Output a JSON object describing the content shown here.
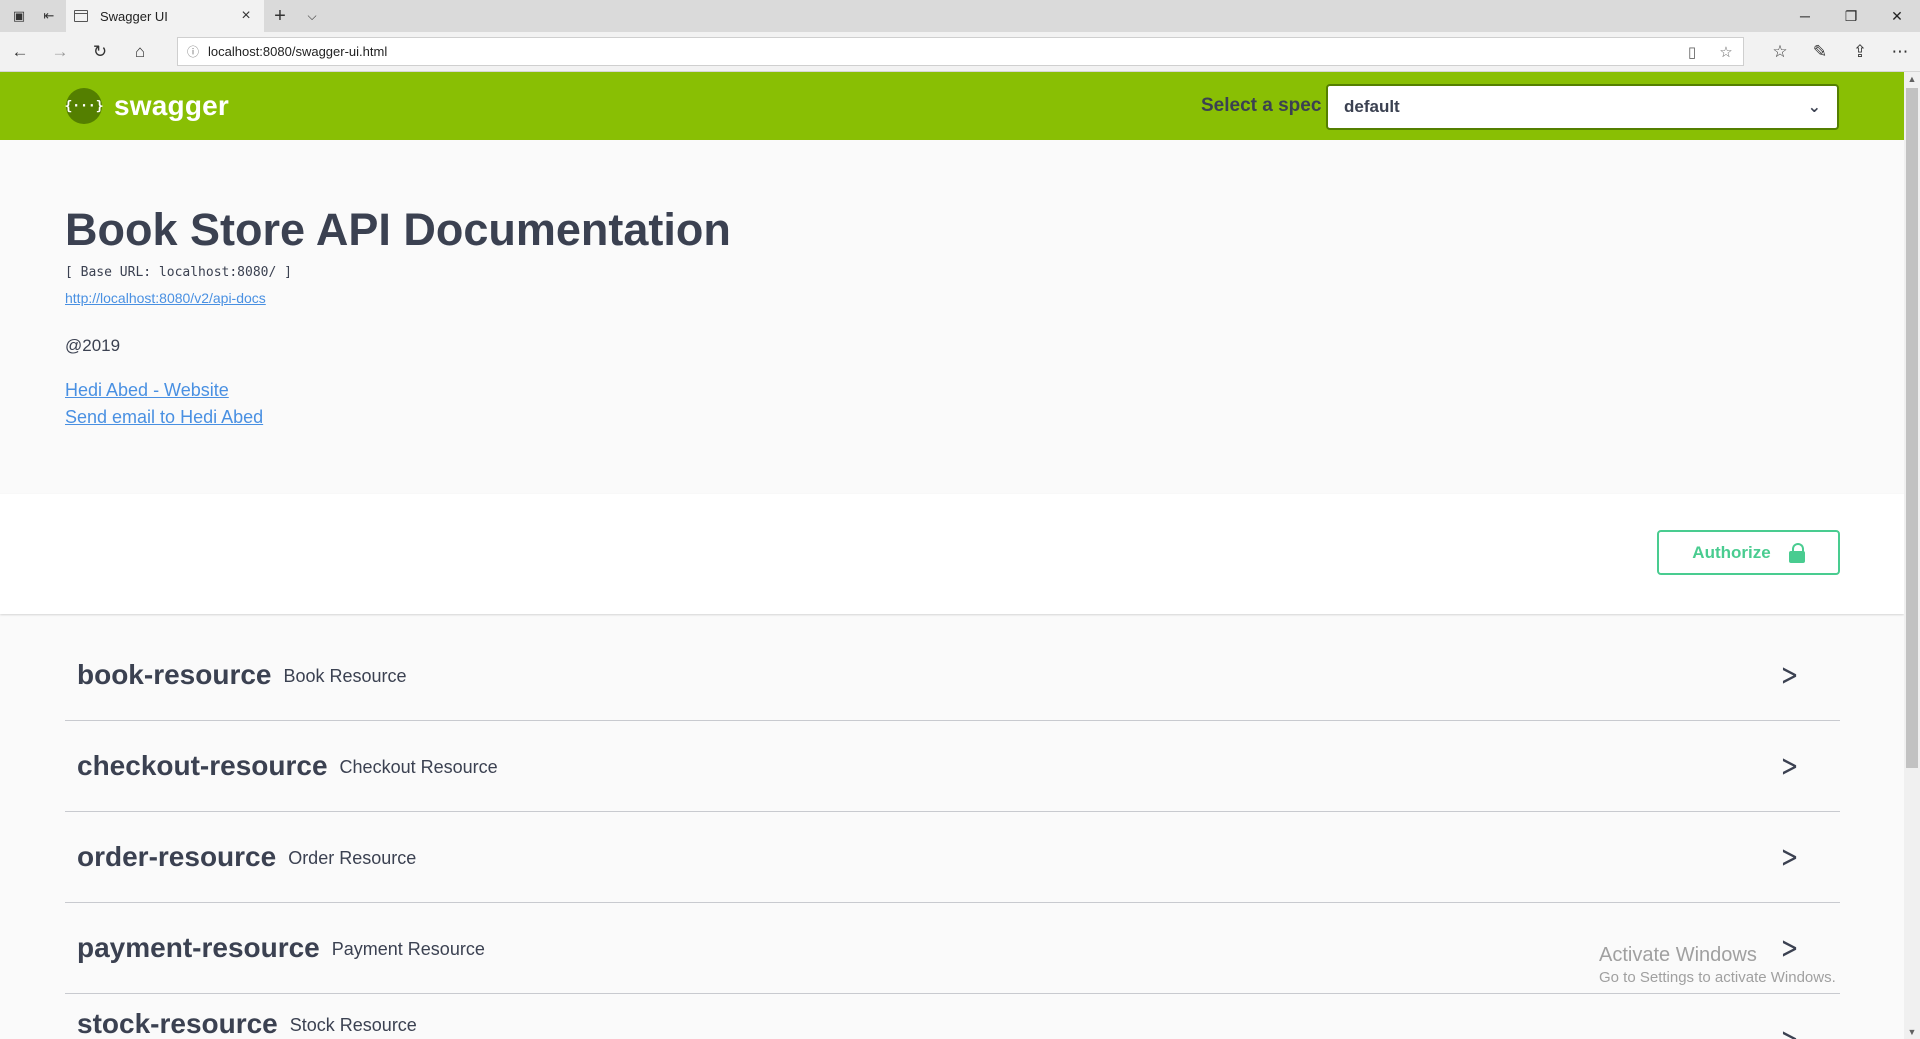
{
  "browser": {
    "tab_title": "Swagger UI",
    "tab_close": "×",
    "new_tab": "+",
    "tab_menu": "⌵",
    "url": "localhost:8080/swagger-ui.html",
    "window_controls": {
      "minimize": "─",
      "maximize": "❐",
      "close": "✕"
    }
  },
  "topbar": {
    "logo_mark": "{···}",
    "logo_text": "swagger",
    "spec_label": "Select a spec",
    "spec_value": "default"
  },
  "info": {
    "title": "Book Store API Documentation",
    "base_url": "[ Base URL: localhost:8080/ ]",
    "docs_link": "http://localhost:8080/v2/api-docs",
    "copyright": "@2019",
    "contact_website": "Hedi Abed - Website",
    "contact_email": "Send email to Hedi Abed"
  },
  "scheme": {
    "authorize_label": "Authorize"
  },
  "tags": [
    {
      "name": "book-resource",
      "description": "Book Resource"
    },
    {
      "name": "checkout-resource",
      "description": "Checkout Resource"
    },
    {
      "name": "order-resource",
      "description": "Order Resource"
    },
    {
      "name": "payment-resource",
      "description": "Payment Resource"
    },
    {
      "name": "stock-resource",
      "description": "Stock Resource"
    }
  ],
  "watermark": {
    "line1": "Activate Windows",
    "line2": "Go to Settings to activate Windows."
  },
  "colors": {
    "topbar": "#89bf04",
    "authorize": "#49cc90",
    "link": "#4990e2",
    "text": "#3b4151"
  }
}
